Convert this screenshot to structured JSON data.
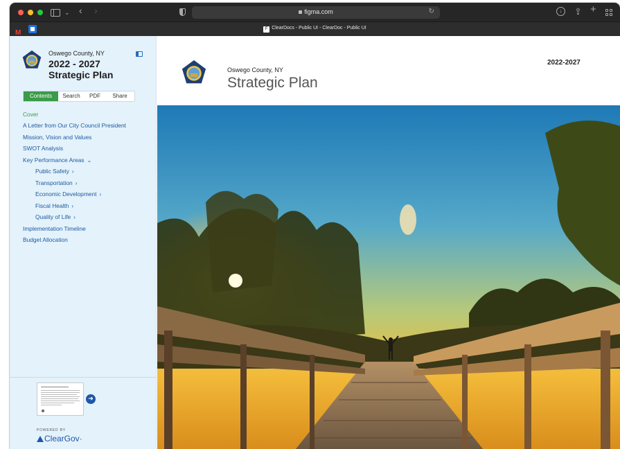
{
  "browser": {
    "url": "figma.com",
    "tab_title": "ClearDocs - Public UI - ClearDoc - Public UI",
    "icons": [
      "sidebar-toggle-icon",
      "chevron-down-icon",
      "back-icon",
      "forward-icon",
      "shield-icon",
      "lock-icon",
      "reload-icon",
      "download-icon",
      "share-icon",
      "new-tab-icon",
      "tab-overview-icon",
      "gmail-icon",
      "calendar-icon",
      "figma-icon"
    ]
  },
  "sidebar": {
    "county": "Oswego County, NY",
    "title_line1": "2022 - 2027",
    "title_line2": "Strategic Plan",
    "tabs": [
      {
        "label": "Contents",
        "active": true
      },
      {
        "label": "Search"
      },
      {
        "label": "PDF"
      },
      {
        "label": "Share"
      }
    ],
    "toc": [
      {
        "label": "Cover",
        "active": true
      },
      {
        "label": "A Letter from Our City Council President"
      },
      {
        "label": "Mission, Vision and Values"
      },
      {
        "label": "SWOT Analysis"
      },
      {
        "label": "Key Performance Areas",
        "expanded": true
      },
      {
        "label": "Public Safety",
        "sub": true
      },
      {
        "label": "Transportation",
        "sub": true
      },
      {
        "label": "Economic Development",
        "sub": true
      },
      {
        "label": "Fiscal Health",
        "sub": true
      },
      {
        "label": "Quality of Life",
        "sub": true
      },
      {
        "label": "Implementation Timeline"
      },
      {
        "label": "Budget Allocation"
      }
    ],
    "powered_by": "POWERED BY",
    "brand": "ClearGov",
    "brand_mark": "·"
  },
  "document": {
    "county": "Oswego County, NY",
    "title": "Strategic Plan",
    "years": "2022-2027"
  },
  "colors": {
    "accent_green": "#3b9b48",
    "link_blue": "#1e5aa0",
    "sidebar_bg": "#e4f2fb",
    "brand_blue": "#1f57a7"
  }
}
